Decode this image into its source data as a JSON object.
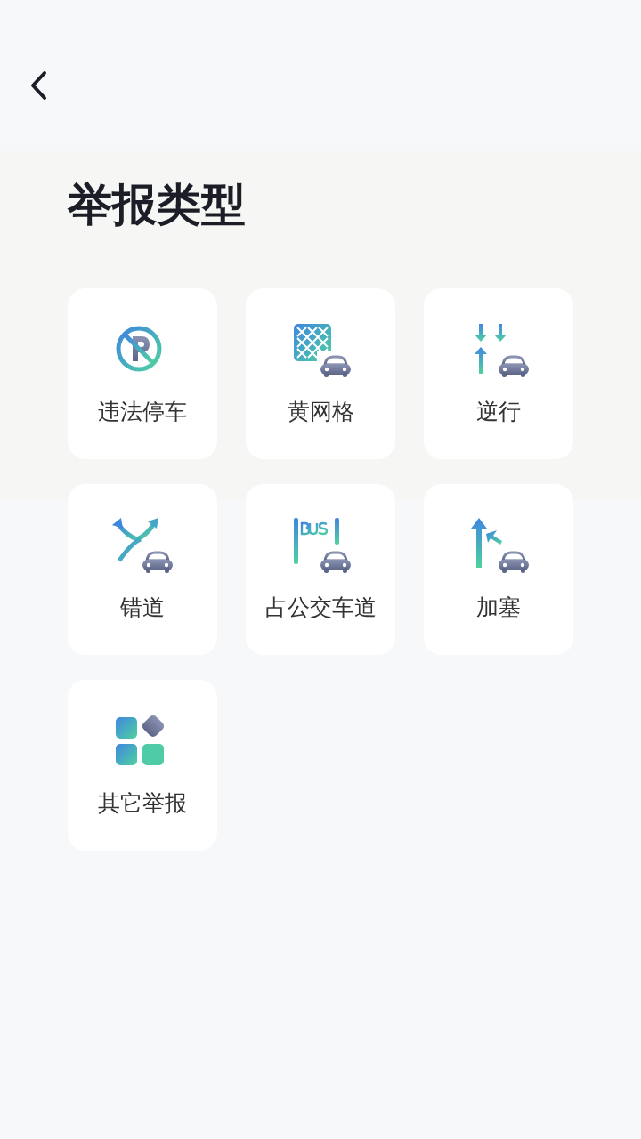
{
  "report_sheet": {
    "title": "举报类型",
    "items": [
      {
        "kind": "no_parking",
        "label": "违法停车"
      },
      {
        "kind": "yellow_grid",
        "label": "黄网格"
      },
      {
        "kind": "wrong_way",
        "label": "逆行"
      },
      {
        "kind": "wrong_lane",
        "label": "错道"
      },
      {
        "kind": "bus_lane",
        "label": "占公交车道"
      },
      {
        "kind": "cut_in",
        "label": "加塞"
      },
      {
        "kind": "other",
        "label": "其它举报"
      }
    ]
  }
}
